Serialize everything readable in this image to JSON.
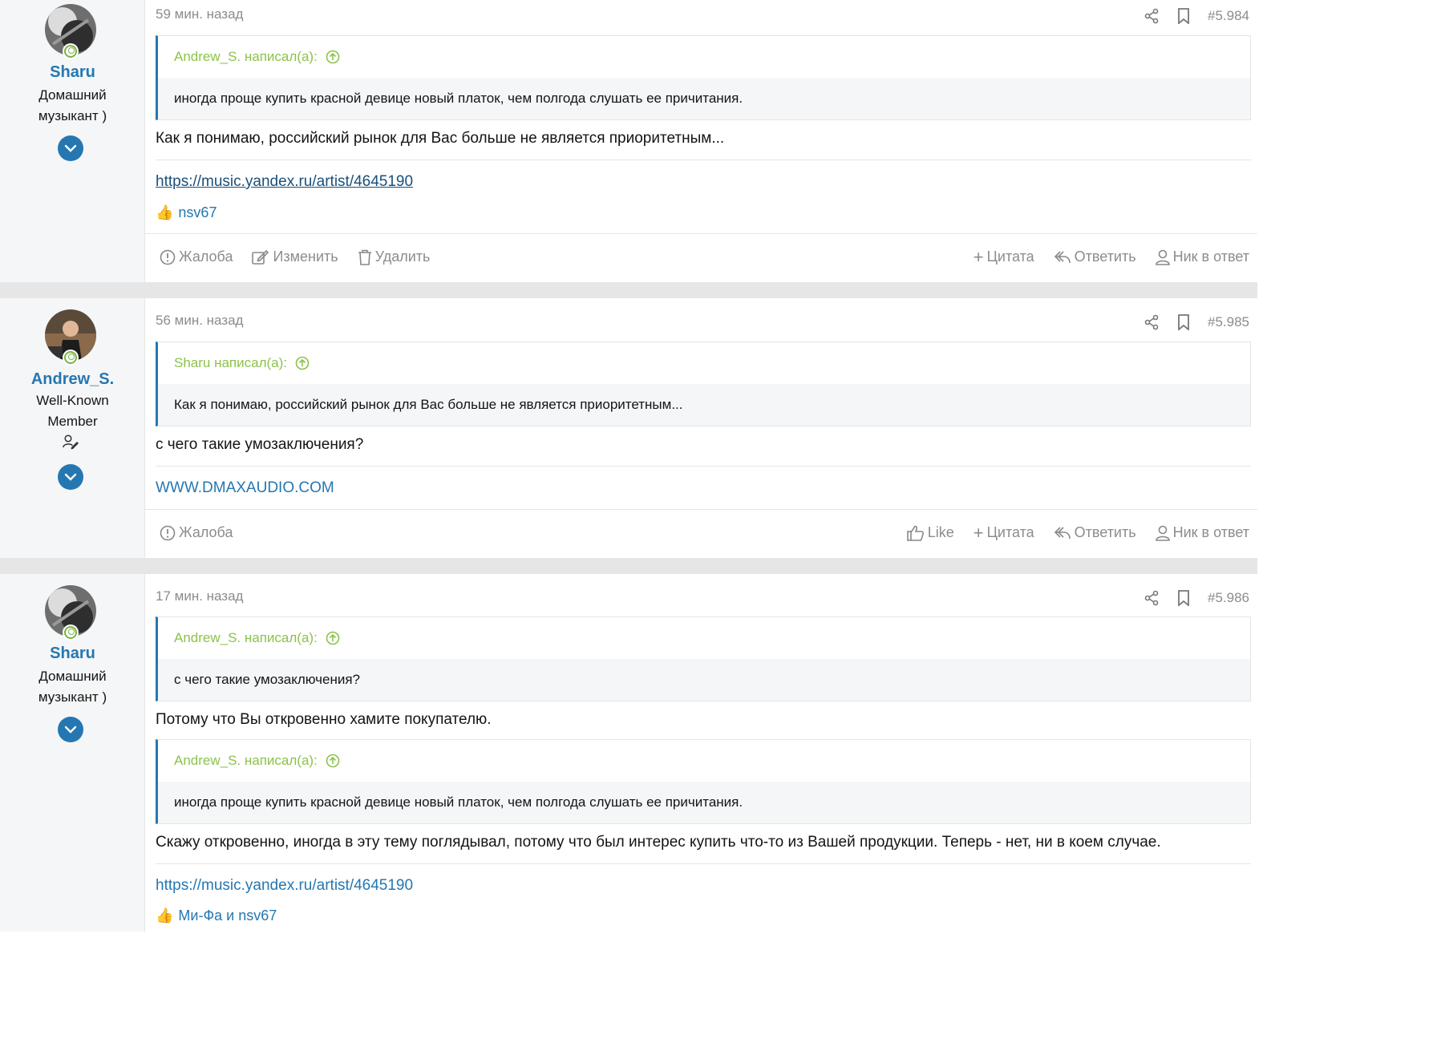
{
  "posts": [
    {
      "username": "Sharu",
      "user_title": "Домашний музыкант )",
      "time": "59 мин. назад",
      "post_number": "#5.984",
      "quotes": [
        {
          "author": "Andrew_S. написал(а):",
          "text": "иногда проще купить красной девице новый платок, чем полгода слушать ее причитания."
        }
      ],
      "text": "Как я понимаю, российский рынок для Вас больше не является приоритетным...",
      "signature_link": "https://music.yandex.ru/artist/4645190",
      "reactions": "nsv67",
      "actions_left": [
        "Жалоба",
        "Изменить",
        "Удалить"
      ],
      "actions_right": [
        "Цитата",
        "Ответить",
        "Ник в ответ"
      ]
    },
    {
      "username": "Andrew_S.",
      "user_title_line1": "Well-Known",
      "user_title_line2": "Member",
      "time": "56 мин. назад",
      "post_number": "#5.985",
      "quotes": [
        {
          "author": "Sharu написал(а):",
          "text": "Как я понимаю, российский рынок для Вас больше не является приоритетным..."
        }
      ],
      "text": "с чего такие умозаключения?",
      "signature_link": "WWW.DMAXAUDIO.COM",
      "actions_left": [
        "Жалоба"
      ],
      "actions_right": [
        "Like",
        "Цитата",
        "Ответить",
        "Ник в ответ"
      ]
    },
    {
      "username": "Sharu",
      "user_title": "Домашний музыкант )",
      "time": "17 мин. назад",
      "post_number": "#5.986",
      "quotes": [
        {
          "author": "Andrew_S. написал(а):",
          "text": "с чего такие умозаключения?"
        },
        {
          "author": "Andrew_S. написал(а):",
          "text": "иногда проще купить красной девице новый платок, чем полгода слушать ее причитания."
        }
      ],
      "text1": "Потому что Вы откровенно хамите покупателю.",
      "text2": "Скажу откровенно, иногда в эту тему поглядывал, потому что был интерес купить что-то из Вашей продукции. Теперь - нет, ни в коем случае.",
      "signature_link": "https://music.yandex.ru/artist/4645190",
      "reactions": "Ми-Фа и nsv67"
    }
  ],
  "colors": {
    "accent": "#2577b1",
    "quote_author": "#8bc34a",
    "muted": "#8c8c8c"
  }
}
